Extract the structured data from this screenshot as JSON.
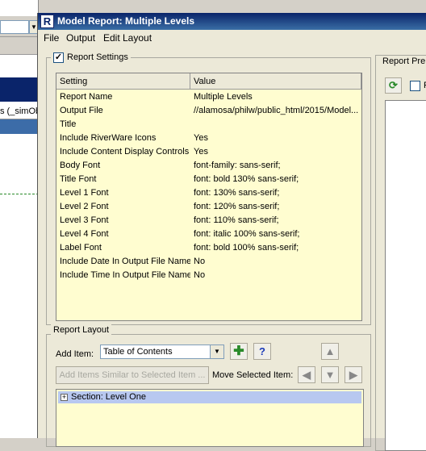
{
  "background_window": {
    "partial_label": "s (_simOb"
  },
  "window": {
    "title": "Model Report: Multiple Levels",
    "app_icon": "R"
  },
  "menu": [
    "File",
    "Output",
    "Edit Layout"
  ],
  "settings": {
    "legend": "Report Settings",
    "checked": true,
    "columns": [
      "Setting",
      "Value"
    ],
    "rows": [
      {
        "setting": "Report Name",
        "value": "Multiple Levels"
      },
      {
        "setting": "Output File",
        "value": "//alamosa/philw/public_html/2015/Model..."
      },
      {
        "setting": "Title",
        "value": ""
      },
      {
        "setting": "Include RiverWare Icons",
        "value": "Yes"
      },
      {
        "setting": "Include Content Display Controls",
        "value": "Yes"
      },
      {
        "setting": "Body Font",
        "value": "font-family: sans-serif;"
      },
      {
        "setting": "Title Font",
        "value": "font: bold 130% sans-serif;"
      },
      {
        "setting": "Level 1 Font",
        "value": "font: 130% sans-serif;"
      },
      {
        "setting": "Level 2 Font",
        "value": "font: 120% sans-serif;"
      },
      {
        "setting": "Level 3 Font",
        "value": "font: 110% sans-serif;"
      },
      {
        "setting": "Level 4 Font",
        "value": "font: italic 100% sans-serif;"
      },
      {
        "setting": "Label Font",
        "value": "font: bold 100% sans-serif;"
      },
      {
        "setting": "Include Date In Output File Name",
        "value": "No"
      },
      {
        "setting": "Include Time In Output File Name",
        "value": "No"
      }
    ]
  },
  "layout": {
    "legend": "Report Layout",
    "add_item_label": "Add Item:",
    "add_item_selected": "Table of Contents",
    "add_similar_label": "Add Items Similar to Selected Item ...",
    "move_label": "Move Selected Item:",
    "help_label": "?",
    "tree": [
      {
        "label": "Section: Level One",
        "expander": "+"
      }
    ]
  },
  "preview": {
    "legend": "Report Pre",
    "checkbox_label": "P"
  },
  "icons": {
    "add": "plus-icon",
    "help": "help-icon",
    "move_up": "arrow-up-icon",
    "move_down": "arrow-down-icon",
    "move_left": "arrow-left-icon",
    "move_right": "arrow-right-icon",
    "refresh": "refresh-icon"
  },
  "colors": {
    "title_bar": "#0a246a",
    "table_bg": "#fffdd0",
    "tree_selection": "#b8c8f0",
    "add_icon": "#2a8a2a",
    "help_icon": "#1a3ab8"
  }
}
